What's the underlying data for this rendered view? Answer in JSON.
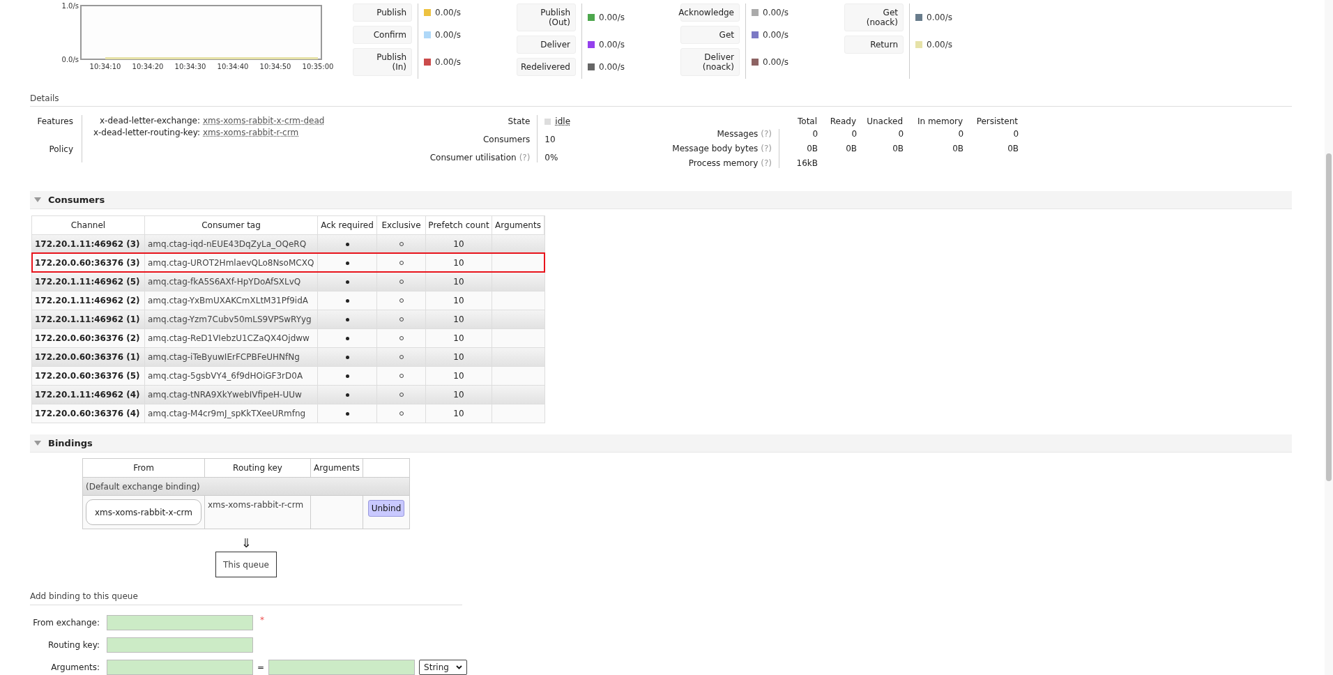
{
  "chart": {
    "chart_data": {
      "type": "line",
      "x": [
        "10:34:10",
        "10:34:20",
        "10:34:30",
        "10:34:40",
        "10:34:50",
        "10:35:00"
      ],
      "series": [
        {
          "color": "#e6e2a8",
          "values": [
            0,
            0,
            0,
            0,
            0,
            0
          ]
        }
      ],
      "ylim": [
        0,
        1
      ],
      "yticks": [
        {
          "value": 0,
          "label": "0.0/s"
        },
        {
          "value": 1,
          "label": "1.0/s"
        }
      ]
    }
  },
  "metric_groups": [
    {
      "items": [
        {
          "label": [
            "Publish"
          ],
          "value": "0.00/s",
          "color": "#edc240"
        },
        {
          "label": [
            "Confirm"
          ],
          "value": "0.00/s",
          "color": "#afd8f8"
        },
        {
          "label": [
            "Publish",
            "(In)"
          ],
          "value": "0.00/s",
          "color": "#cb4b4b"
        }
      ]
    },
    {
      "items": [
        {
          "label": [
            "Publish",
            "(Out)"
          ],
          "value": "0.00/s",
          "color": "#4da74d"
        },
        {
          "label": [
            "Deliver"
          ],
          "value": "0.00/s",
          "color": "#9440ed"
        },
        {
          "label": [
            "Redelivered"
          ],
          "value": "0.00/s",
          "color": "#666666"
        }
      ]
    },
    {
      "items": [
        {
          "label": [
            "Acknowledge"
          ],
          "value": "0.00/s",
          "color": "#aaaaaa"
        },
        {
          "label": [
            "Get"
          ],
          "value": "0.00/s",
          "color": "#7c79c4"
        },
        {
          "label": [
            "Deliver",
            "(noack)"
          ],
          "value": "0.00/s",
          "color": "#8d6363"
        }
      ]
    },
    {
      "items": [
        {
          "label": [
            "Get",
            "(noack)"
          ],
          "value": "0.00/s",
          "color": "#687c8c"
        },
        {
          "label": [
            "Return"
          ],
          "value": "0.00/s",
          "color": "#e6e2a8"
        }
      ]
    }
  ],
  "details": {
    "heading": "Details",
    "features_label": "Features",
    "features": [
      {
        "key": "x-dead-letter-exchange:",
        "value": "xms-xoms-rabbit-x-crm-dead"
      },
      {
        "key": "x-dead-letter-routing-key:",
        "value": "xms-xoms-rabbit-r-crm"
      }
    ],
    "policy_label": "Policy",
    "state": {
      "label": "State",
      "value": "idle"
    },
    "consumers": {
      "label": "Consumers",
      "value": "10"
    },
    "utilisation": {
      "label": "Consumer utilisation",
      "help": "(?)",
      "value": "0%"
    },
    "message_columns": [
      "Total",
      "Ready",
      "Unacked",
      "In memory",
      "Persistent"
    ],
    "message_rows": [
      {
        "label": "Messages",
        "help": "(?)",
        "values": [
          "0",
          "0",
          "0",
          "0",
          "0"
        ]
      },
      {
        "label": "Message body bytes",
        "help": "(?)",
        "values": [
          "0B",
          "0B",
          "0B",
          "0B",
          "0B"
        ]
      },
      {
        "label": "Process memory",
        "help": "(?)",
        "values": [
          "16kB"
        ]
      }
    ]
  },
  "consumers": {
    "title": "Consumers",
    "expanded": true,
    "columns": [
      "Channel",
      "Consumer tag",
      "Ack required",
      "Exclusive",
      "Prefetch count",
      "Arguments"
    ],
    "rows": [
      {
        "channel": "172.20.1.11:46962 (3)",
        "tag": "amq.ctag-iqd-nEUE43DqZyLa_OQeRQ",
        "ack_required": true,
        "exclusive": false,
        "prefetch": "10",
        "highlighted": false
      },
      {
        "channel": "172.20.0.60:36376 (3)",
        "tag": "amq.ctag-UROT2HmlaevQLo8NsoMCXQ",
        "ack_required": true,
        "exclusive": false,
        "prefetch": "10",
        "highlighted": true
      },
      {
        "channel": "172.20.1.11:46962 (5)",
        "tag": "amq.ctag-fkA5S6AXf-HpYDoAfSXLvQ",
        "ack_required": true,
        "exclusive": false,
        "prefetch": "10",
        "highlighted": false
      },
      {
        "channel": "172.20.1.11:46962 (2)",
        "tag": "amq.ctag-YxBmUXAKCmXLtM31Pf9idA",
        "ack_required": true,
        "exclusive": false,
        "prefetch": "10",
        "highlighted": false
      },
      {
        "channel": "172.20.1.11:46962 (1)",
        "tag": "amq.ctag-Yzm7Cubv50mLS9VPSwRYyg",
        "ack_required": true,
        "exclusive": false,
        "prefetch": "10",
        "highlighted": false
      },
      {
        "channel": "172.20.0.60:36376 (2)",
        "tag": "amq.ctag-ReD1VIebzU1CZaQX4Ojdww",
        "ack_required": true,
        "exclusive": false,
        "prefetch": "10",
        "highlighted": false
      },
      {
        "channel": "172.20.0.60:36376 (1)",
        "tag": "amq.ctag-iTeByuwIErFCPBFeUHNfNg",
        "ack_required": true,
        "exclusive": false,
        "prefetch": "10",
        "highlighted": false
      },
      {
        "channel": "172.20.0.60:36376 (5)",
        "tag": "amq.ctag-5gsbVY4_6f9dHOiGF3rD0A",
        "ack_required": true,
        "exclusive": false,
        "prefetch": "10",
        "highlighted": false
      },
      {
        "channel": "172.20.1.11:46962 (4)",
        "tag": "amq.ctag-tNRA9XkYwebIVfipeH-UUw",
        "ack_required": true,
        "exclusive": false,
        "prefetch": "10",
        "highlighted": false
      },
      {
        "channel": "172.20.0.60:36376 (4)",
        "tag": "amq.ctag-M4cr9mJ_spKkTXeeURmfng",
        "ack_required": true,
        "exclusive": false,
        "prefetch": "10",
        "highlighted": false
      }
    ]
  },
  "bindings": {
    "title": "Bindings",
    "expanded": true,
    "columns": [
      "From",
      "Routing key",
      "Arguments"
    ],
    "default_label": "(Default exchange binding)",
    "rows": [
      {
        "from": "xms-xoms-rabbit-x-crm",
        "routing_key": "xms-xoms-rabbit-r-crm",
        "action": "Unbind"
      }
    ],
    "arrow": "⇓",
    "target": "This queue"
  },
  "add_binding": {
    "heading": "Add binding to this queue",
    "fields": [
      {
        "kind": "single",
        "label": "From exchange:",
        "required_mark": "*"
      },
      {
        "kind": "single",
        "label": "Routing key:"
      },
      {
        "kind": "pair",
        "label": "Arguments:",
        "separator": "=",
        "type_value": "String"
      }
    ]
  }
}
